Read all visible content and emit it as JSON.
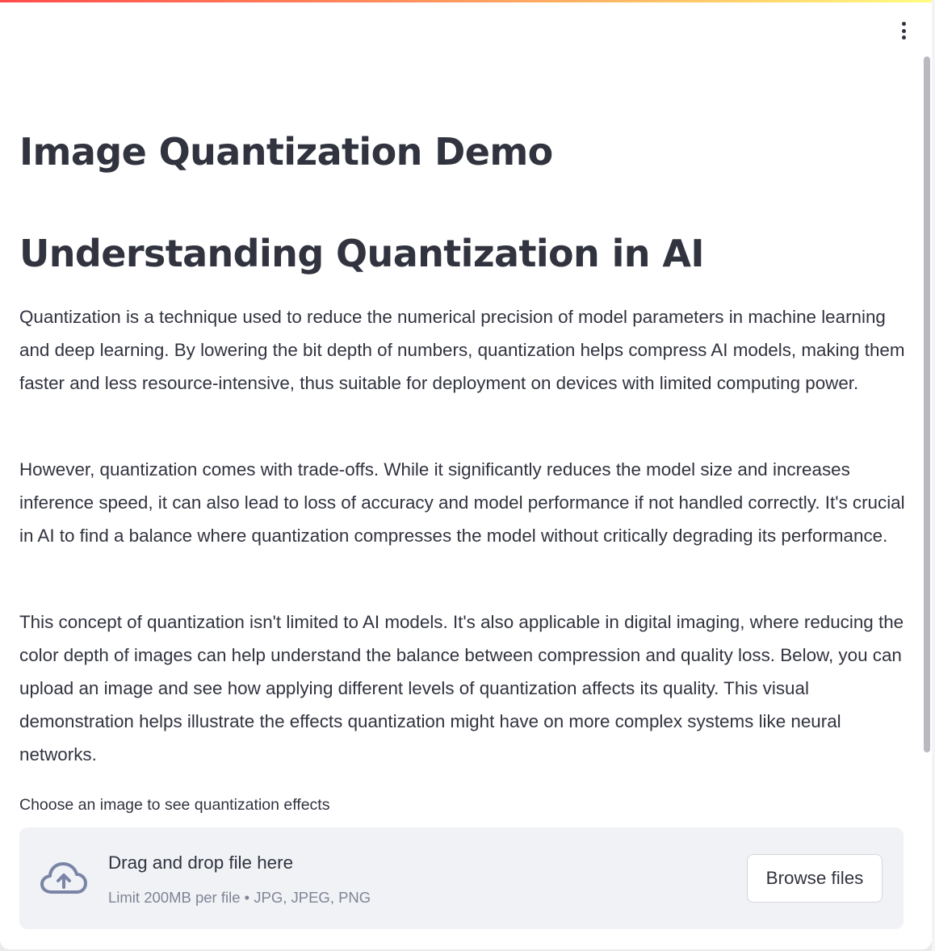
{
  "app": {
    "title": "Image Quantization Demo",
    "accent_gradient": [
      "#ff4b4b",
      "#ffd36b",
      "#fffd80"
    ],
    "menu_icon": "vertical-ellipsis-icon"
  },
  "main": {
    "heading": "Understanding Quantization in AI",
    "paragraphs": [
      "Quantization is a technique used to reduce the numerical precision of model parameters in machine learning and deep learning. By lowering the bit depth of numbers, quantization helps compress AI models, making them faster and less resource-intensive, thus suitable for deployment on devices with limited computing power.",
      "However, quantization comes with trade-offs. While it significantly reduces the model size and increases inference speed, it can also lead to loss of accuracy and model performance if not handled correctly. It's crucial in AI to find a balance where quantization compresses the model without critically degrading its performance.",
      "This concept of quantization isn't limited to AI models. It's also applicable in digital imaging, where reducing the color depth of images can help understand the balance between compression and quality loss. Below, you can upload an image and see how applying different levels of quantization affects its quality. This visual demonstration helps illustrate the effects quantization might have on more complex systems like neural networks."
    ]
  },
  "uploader": {
    "label": "Choose an image to see quantization effects",
    "drop_text": "Drag and drop file here",
    "limit_text": "Limit 200MB per file • JPG, JPEG, PNG",
    "browse_label": "Browse files",
    "icon": "cloud-upload-icon"
  }
}
